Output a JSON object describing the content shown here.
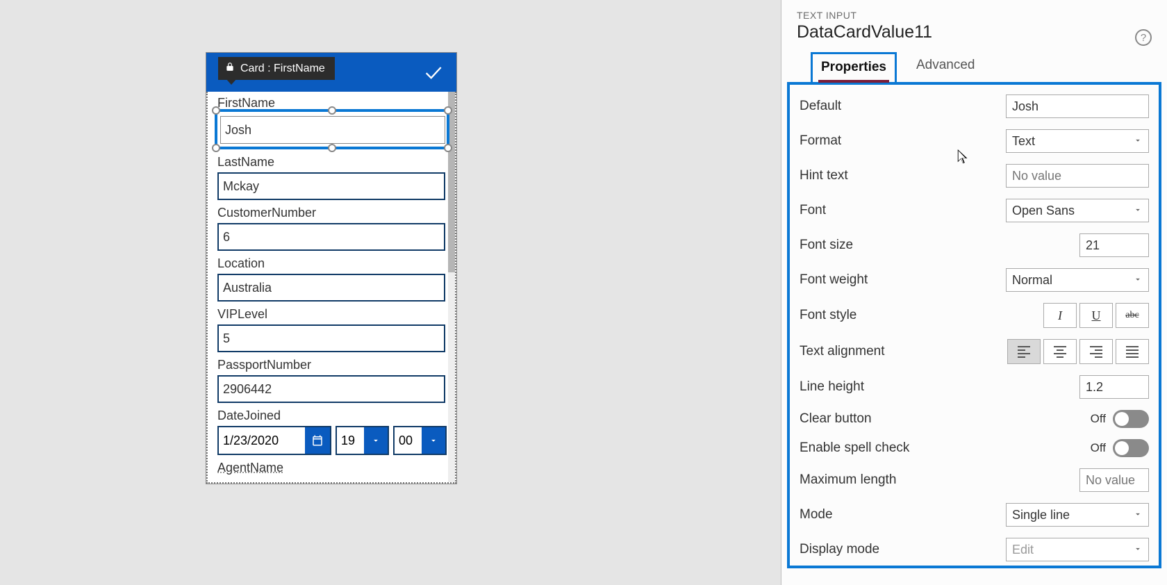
{
  "canvas": {
    "card_title": "Card : FirstName",
    "fields": {
      "firstName": {
        "label": "FirstName",
        "value": "Josh"
      },
      "lastName": {
        "label": "LastName",
        "value": "Mckay"
      },
      "customerNumber": {
        "label": "CustomerNumber",
        "value": "6"
      },
      "location": {
        "label": "Location",
        "value": "Australia"
      },
      "vipLevel": {
        "label": "VIPLevel",
        "value": "5"
      },
      "passportNumber": {
        "label": "PassportNumber",
        "value": "2906442"
      },
      "dateJoined": {
        "label": "DateJoined",
        "date": "1/23/2020",
        "hour": "19",
        "minute": "00"
      },
      "agentName": {
        "label": "AgentName"
      }
    }
  },
  "panel": {
    "type_label": "TEXT INPUT",
    "control_name": "DataCardValue11",
    "tabs": {
      "properties": "Properties",
      "advanced": "Advanced"
    },
    "props": {
      "default": {
        "label": "Default",
        "value": "Josh"
      },
      "format": {
        "label": "Format",
        "value": "Text"
      },
      "hint": {
        "label": "Hint text",
        "placeholder": "No value"
      },
      "font": {
        "label": "Font",
        "value": "Open Sans"
      },
      "fontSize": {
        "label": "Font size",
        "value": "21"
      },
      "fontWeight": {
        "label": "Font weight",
        "value": "Normal"
      },
      "fontStyle": {
        "label": "Font style"
      },
      "textAlign": {
        "label": "Text alignment"
      },
      "lineHeight": {
        "label": "Line height",
        "value": "1.2"
      },
      "clearButton": {
        "label": "Clear button",
        "state": "Off"
      },
      "spellCheck": {
        "label": "Enable spell check",
        "state": "Off"
      },
      "maxLength": {
        "label": "Maximum length",
        "placeholder": "No value"
      },
      "mode": {
        "label": "Mode",
        "value": "Single line"
      },
      "displayMode": {
        "label": "Display mode",
        "value": "Edit"
      }
    },
    "style_glyphs": {
      "italic": "I",
      "underline": "U",
      "strike": "abc"
    }
  }
}
